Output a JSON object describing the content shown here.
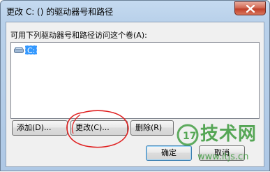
{
  "window": {
    "title": "更改 C: () 的驱动器号和路径"
  },
  "dialog": {
    "prompt": "可用下列驱动器号和路径访问这个卷(A):",
    "list_items": [
      {
        "label": "C:",
        "icon": "drive-icon",
        "selected": true
      }
    ],
    "buttons": {
      "add": "添加(D)...",
      "change": "更改(C)...",
      "remove": "删除(R)",
      "ok": "确定",
      "cancel": "取消"
    }
  },
  "watermark": {
    "text": "技术网",
    "url": "www.itjs.cn"
  },
  "colors": {
    "selection": "#3399ff",
    "annotation": "#e02020",
    "watermark": "#3a9a3a"
  }
}
